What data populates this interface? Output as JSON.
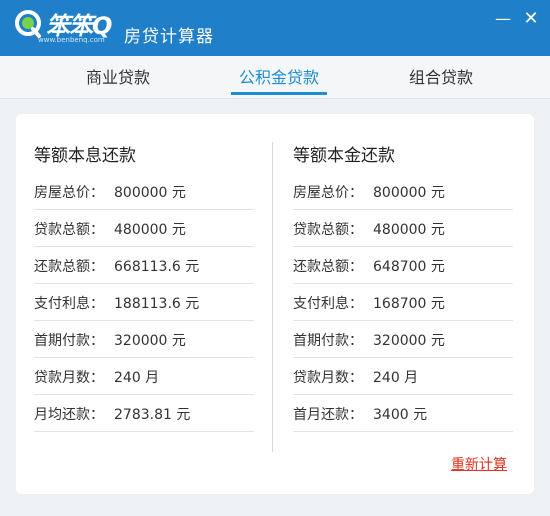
{
  "app": {
    "brand": "笨笨Q",
    "brand_url": "www.benbenq.com",
    "title": "房贷计算器",
    "colors": {
      "titlebar": "#1f7fc9",
      "accent": "#1e8ed3",
      "link": "#e0301e"
    }
  },
  "window_controls": {
    "minimize": "—",
    "close": "✕"
  },
  "tabs": [
    {
      "label": "商业贷款",
      "active": false
    },
    {
      "label": "公积金贷款",
      "active": true
    },
    {
      "label": "组合贷款",
      "active": false
    }
  ],
  "left": {
    "title": "等额本息还款",
    "rows": [
      {
        "label": "房屋总价：",
        "value": "800000 元"
      },
      {
        "label": "贷款总额：",
        "value": "480000 元"
      },
      {
        "label": "还款总额：",
        "value": "668113.6 元"
      },
      {
        "label": "支付利息：",
        "value": "188113.6 元"
      },
      {
        "label": "首期付款：",
        "value": "320000 元"
      },
      {
        "label": "贷款月数：",
        "value": "240 月"
      },
      {
        "label": "月均还款：",
        "value": "2783.81 元"
      }
    ]
  },
  "right": {
    "title": "等额本金还款",
    "rows": [
      {
        "label": "房屋总价：",
        "value": "800000 元"
      },
      {
        "label": "贷款总额：",
        "value": "480000 元"
      },
      {
        "label": "还款总额：",
        "value": "648700 元"
      },
      {
        "label": "支付利息：",
        "value": "168700 元"
      },
      {
        "label": "首期付款：",
        "value": "320000 元"
      },
      {
        "label": "贷款月数：",
        "value": "240 月"
      },
      {
        "label": "首月还款：",
        "value": "3400 元"
      }
    ]
  },
  "actions": {
    "recalculate": "重新计算"
  }
}
